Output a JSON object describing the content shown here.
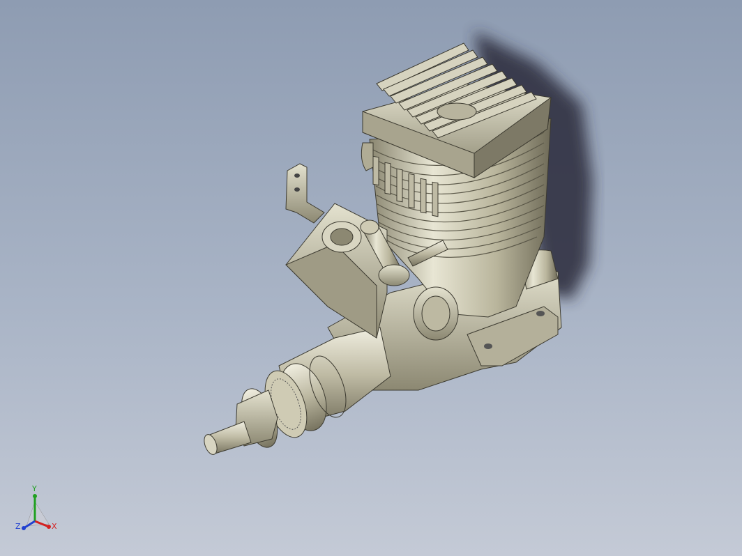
{
  "viewport": {
    "background_top": "#8e9cb2",
    "background_bottom": "#c4cad6"
  },
  "model": {
    "description_icon": "rc-engine-model-icon",
    "body_color": "#c9c6b0",
    "shadow_color": "#2c2c3a"
  },
  "triad": {
    "x_label": "X",
    "y_label": "Y",
    "z_label": "Z",
    "x_color": "#d42020",
    "y_color": "#20a020",
    "z_color": "#2040d0"
  }
}
